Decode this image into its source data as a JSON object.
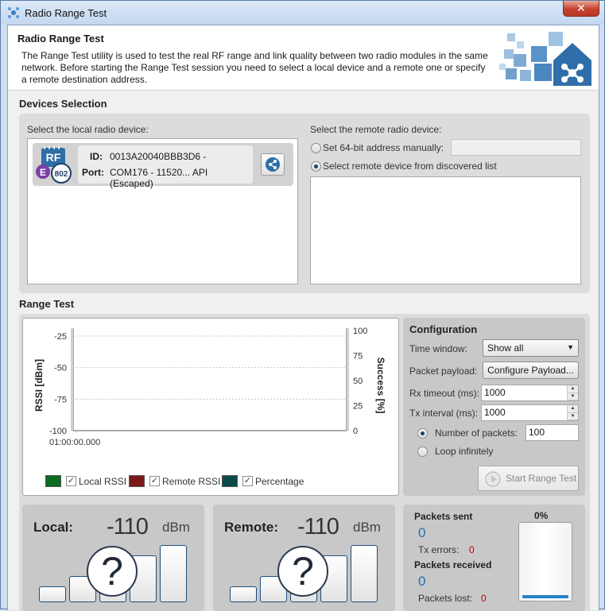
{
  "window": {
    "title": "Radio Range Test",
    "close_label": "✕"
  },
  "header": {
    "title": "Radio Range Test",
    "description": "The Range Test utility is used to test the real RF range and link quality between two radio modules in the same network. Before starting the Range Test session you need to select a local device and a remote one or specify a remote destination address."
  },
  "devices": {
    "section_title": "Devices Selection",
    "local_label": "Select the local radio device:",
    "local_device": {
      "id_key": "ID:",
      "id_value": "0013A20040BBB3D6 -",
      "port_key": "Port:",
      "port_value": "COM176 - 11520... API (Escaped)",
      "badge_top": "RF",
      "badge_left": "E",
      "badge_num": "802"
    },
    "remote_label": "Select the remote radio device:",
    "option_manual": "Set 64-bit address manually:",
    "option_discovered": "Select remote device from discovered list",
    "manual_address_value": "",
    "selected_option": "discovered"
  },
  "range_test": {
    "section_title": "Range Test",
    "legend": [
      {
        "label": "Local RSSI",
        "color": "#0b6b1f",
        "checked": true
      },
      {
        "label": "Remote RSSI",
        "color": "#7c1a1a",
        "checked": true
      },
      {
        "label": "Percentage",
        "color": "#0b4a4a",
        "checked": true
      }
    ]
  },
  "configuration": {
    "title": "Configuration",
    "time_window_label": "Time window:",
    "time_window_value": "Show all",
    "packet_payload_label": "Packet payload:",
    "configure_payload_button": "Configure Payload...",
    "rx_timeout_label": "Rx timeout (ms):",
    "rx_timeout_value": "1000",
    "tx_interval_label": "Tx interval (ms):",
    "tx_interval_value": "1000",
    "number_of_packets_label": "Number of packets:",
    "number_of_packets_value": "100",
    "loop_infinitely_label": "Loop infinitely",
    "start_button": "Start Range Test"
  },
  "local_gauge": {
    "title": "Local:",
    "value": "-110",
    "unit": "dBm",
    "unknown_symbol": "?"
  },
  "remote_gauge": {
    "title": "Remote:",
    "value": "-110",
    "unit": "dBm",
    "unknown_symbol": "?"
  },
  "packets": {
    "sent_label": "Packets sent",
    "sent_value": "0",
    "tx_errors_label": "Tx errors:",
    "tx_errors_value": "0",
    "received_label": "Packets received",
    "received_value": "0",
    "lost_label": "Packets lost:",
    "lost_value": "0",
    "progress_label": "0%",
    "progress_fraction": 0
  },
  "chart_data": {
    "type": "line",
    "ylabel": "RSSI [dBm]",
    "y2label": "Success [%]",
    "y_ticks": [
      "-25",
      "-50",
      "-75",
      "-100"
    ],
    "y2_ticks": [
      "100",
      "75",
      "50",
      "25",
      "0"
    ],
    "ylim": [
      -100,
      -25
    ],
    "y2lim": [
      0,
      100
    ],
    "x_ticks": [
      "01:00:00.000"
    ],
    "grid": true,
    "series": []
  }
}
